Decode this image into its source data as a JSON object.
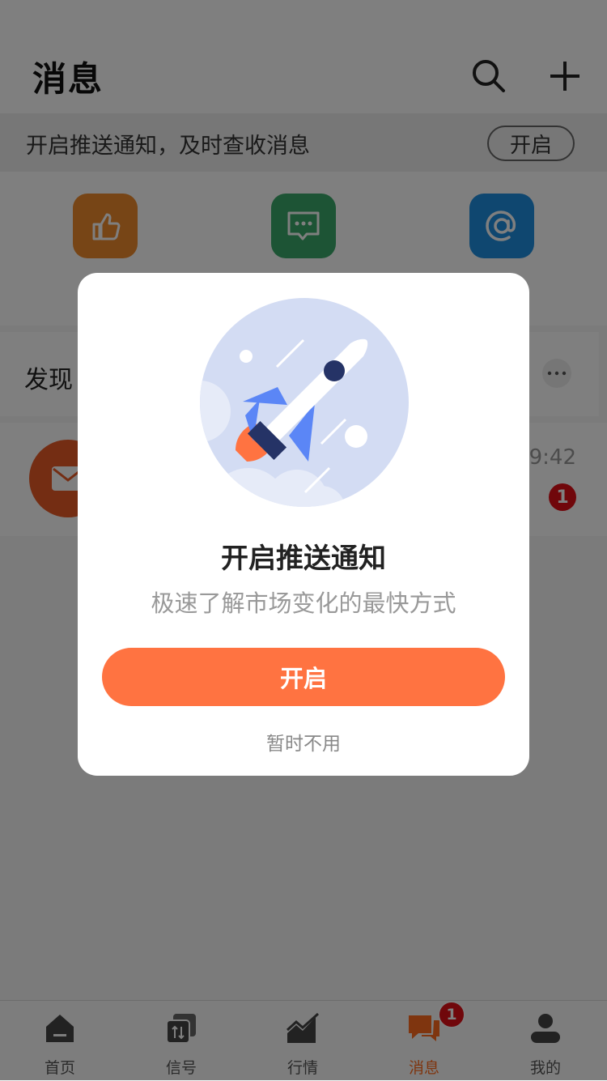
{
  "header": {
    "title": "消息",
    "search_icon": "search-icon",
    "add_icon": "plus-icon"
  },
  "push_bar": {
    "text": "开启推送通知，及时查收消息",
    "button": "开启"
  },
  "quick_icons": [
    {
      "icon": "thumbs-up-icon",
      "color": "#ee8a2c",
      "label": ""
    },
    {
      "icon": "comment-icon",
      "color": "#3aa96a",
      "label": ""
    },
    {
      "icon": "at-icon",
      "color": "#1f8ee0",
      "label": ""
    }
  ],
  "discover": {
    "title": "发现",
    "more_icon": "more-dots-icon"
  },
  "message": {
    "avatar_icon": "mail-icon",
    "time": "19:42",
    "badge": "1"
  },
  "modal": {
    "title": "开启推送通知",
    "subtitle": "极速了解市场变化的最快方式",
    "primary_button": "开启",
    "skip": "暂时不用",
    "illustration": "rocket-icon",
    "accent": "#ff7341"
  },
  "tabs": [
    {
      "label": "首页",
      "icon": "home-icon"
    },
    {
      "label": "信号",
      "icon": "signal-icon"
    },
    {
      "label": "行情",
      "icon": "market-chart-icon"
    },
    {
      "label": "消息",
      "icon": "message-icon",
      "active": true,
      "badge": "1"
    },
    {
      "label": "我的",
      "icon": "profile-icon"
    }
  ]
}
